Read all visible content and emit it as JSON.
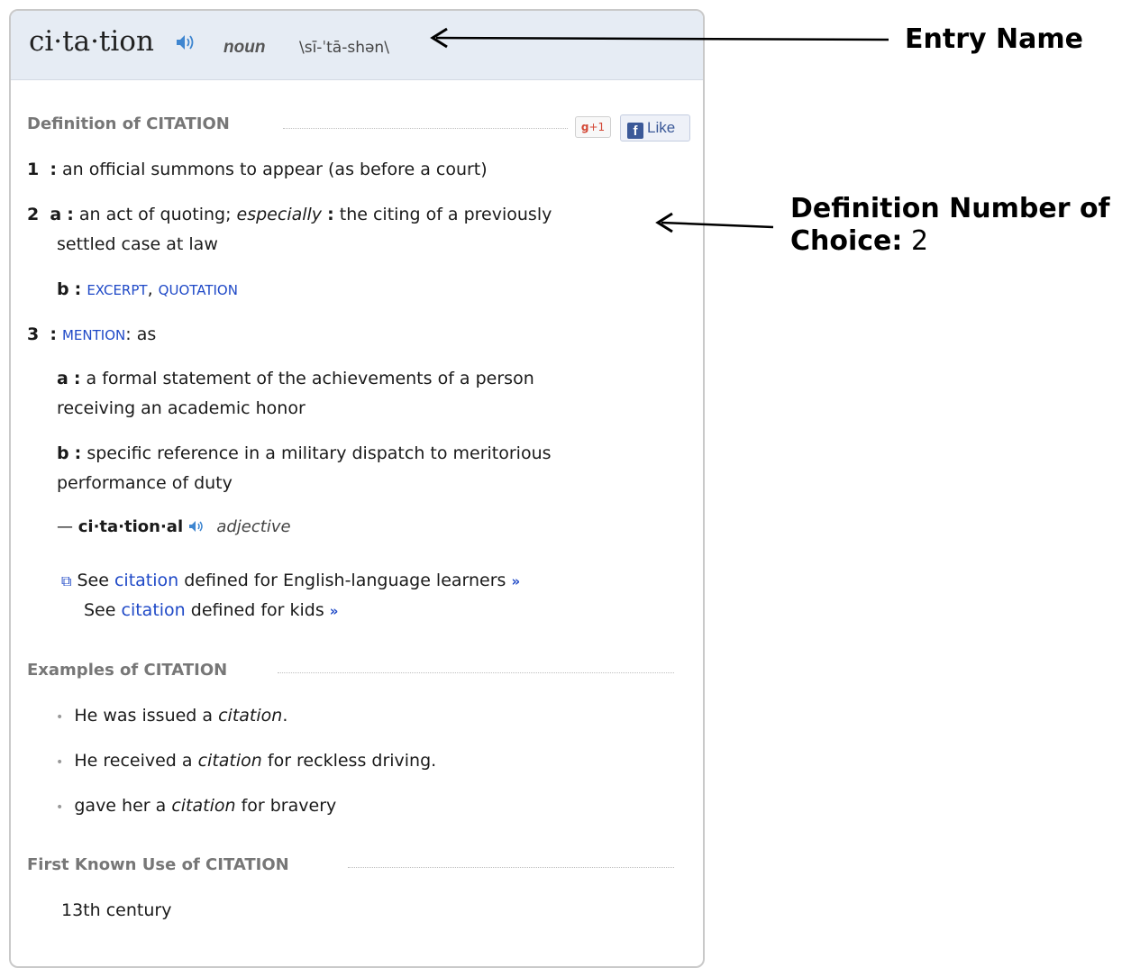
{
  "entry": {
    "headword": "ci·ta·tion",
    "part_of_speech": "noun",
    "pronunciation": "\\sī-ˈtā-shən\\",
    "speaker_icon": "speaker-icon"
  },
  "definition_section": {
    "heading": "Definition of CITATION",
    "gplus_label": "+1",
    "like_label": "Like",
    "items": {
      "d1_num": "1",
      "d1_text": "an official summons to appear (as before a court)",
      "d2_num": "2",
      "d2a_letter": "a",
      "d2a_text_1": "an act of quoting;",
      "d2a_especially": "especially",
      "d2a_text_2": "the citing of a previously",
      "d2a_text_3": "settled case at law",
      "d2b_letter": "b",
      "d2b_link1": "EXCERPT",
      "d2b_link2": "QUOTATION",
      "d3_num": "3",
      "d3_link": "MENTION",
      "d3_suffix": ": as",
      "d3a_letter": "a",
      "d3a_text_1": "a formal statement of the achievements of a person",
      "d3a_text_2": "receiving an academic honor",
      "d3b_letter": "b",
      "d3b_text_1": "specific reference in a military dispatch to meritorious",
      "d3b_text_2": "performance of duty"
    },
    "derived": {
      "dash": "—",
      "word": "ci·ta·tion·al",
      "pos": "adjective"
    },
    "see_learners": {
      "prefix": "See",
      "link": "citation",
      "suffix": "defined for English-language learners",
      "arrow": "»"
    },
    "see_kids": {
      "prefix": "See",
      "link": "citation",
      "suffix": "defined for kids",
      "arrow": "»"
    }
  },
  "examples_section": {
    "heading": "Examples of CITATION",
    "bullet": "•",
    "examples": [
      {
        "before": "He was issued a",
        "word": "citation",
        "after": "."
      },
      {
        "before": "He received a",
        "word": "citation",
        "after": "for reckless driving."
      },
      {
        "before": "gave her a",
        "word": "citation",
        "after": "for bravery"
      }
    ]
  },
  "first_use_section": {
    "heading": "First Known Use of CITATION",
    "value": "13th century"
  },
  "annotations": {
    "entry_name": "Entry Name",
    "definition_choice_line1": "Definition Number of",
    "definition_choice_label": "Choice:",
    "definition_choice_value": "2"
  },
  "colors": {
    "link": "#1f49c7",
    "header_bg": "#e6ecf4",
    "section_heading": "#777777"
  }
}
